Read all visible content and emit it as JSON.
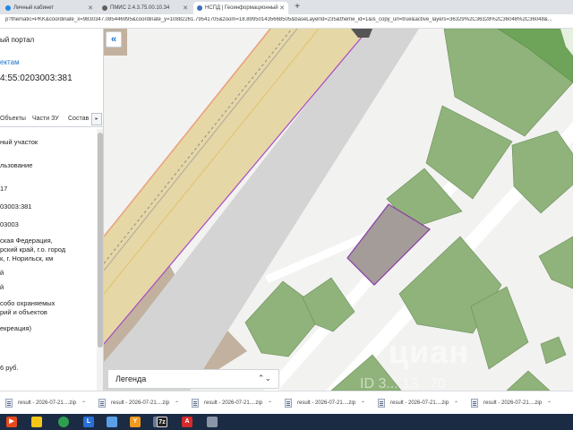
{
  "browser": {
    "tabs": [
      {
        "label": "Личный кабинет",
        "active": false,
        "color": "#1e88e5"
      },
      {
        "label": "ПМИС 2.4.3.75.00.10.34",
        "active": false,
        "color": "#606060"
      },
      {
        "label": "НСПД | Геоинформационный",
        "active": true,
        "color": "#3b6fb6"
      }
    ],
    "new_tab": "+",
    "url": "p?thematic=PKK&coordinate_x=9830347.085446995&coordinate_y=10882261.79541705&zoom=18.899501435668505&baseLayerId=235&theme_id=1&is_copy_url=true&active_layers=36329%2C36328%2C36048%2C36048&..."
  },
  "panel": {
    "title": "ый портал",
    "link": "ектам",
    "cadastral": "4:55:0203003:381",
    "tabs": [
      "Объекты",
      "Части ЗУ",
      "Состав"
    ],
    "tabs_more": "▸",
    "rows": [
      "ный участок",
      "льзование",
      "17",
      "03003:381",
      "03003",
      "ская Федерация,",
      "рский край, г.о. город",
      "к, г. Норильск, км",
      "й",
      "й",
      "собо охраняемых",
      "рий и объектов",
      "екреация)",
      "6 руб."
    ]
  },
  "map": {
    "collapse_label": "«",
    "legend_label": "Легенда",
    "legend_chevron": "⌃⌄",
    "watermark": "циан",
    "watermark_id": "ID 3... 13...70",
    "colors": {
      "background": "#f2f2f0",
      "parcel_green": "#8fb37a",
      "parcel_green_dark": "#6ea35a",
      "selected_parcel": "#a39c98",
      "selected_border": "#8a3aa8",
      "road_band": "#e9d9a8",
      "road_gray": "#c9c9c9",
      "brown_area": "#c2b19e"
    }
  },
  "downloads": [
    {
      "label": "result - 2026-07-21....zip"
    },
    {
      "label": "result - 2026-07-21....zip"
    },
    {
      "label": "result - 2026-07-21....zip"
    },
    {
      "label": "result - 2026-07-21....zip"
    },
    {
      "label": "result - 2026-07-21....zip"
    },
    {
      "label": "result - 2026-07-21....zip"
    }
  ],
  "taskbar": [
    {
      "name": "start-icon",
      "glyph": "▶",
      "color": "#e8491d"
    },
    {
      "name": "explorer-icon",
      "glyph": "",
      "color": "#f5c518"
    },
    {
      "name": "chrome-icon",
      "glyph": "",
      "color": "#2e9e4f"
    },
    {
      "name": "app-icon",
      "glyph": "L",
      "color": "#2a6fd6"
    },
    {
      "name": "app-icon",
      "glyph": "",
      "color": "#5aa0e6"
    },
    {
      "name": "yandex-icon",
      "glyph": "Y",
      "color": "#f29a1d"
    },
    {
      "name": "app-icon",
      "glyph": "",
      "color": "#6a7b92"
    },
    {
      "name": "7zip-icon",
      "glyph": "7z",
      "color": "#222222"
    },
    {
      "name": "pdf-icon",
      "glyph": "A",
      "color": "#d32b2b"
    },
    {
      "name": "app-icon",
      "glyph": "",
      "color": "#8a95a8"
    }
  ]
}
